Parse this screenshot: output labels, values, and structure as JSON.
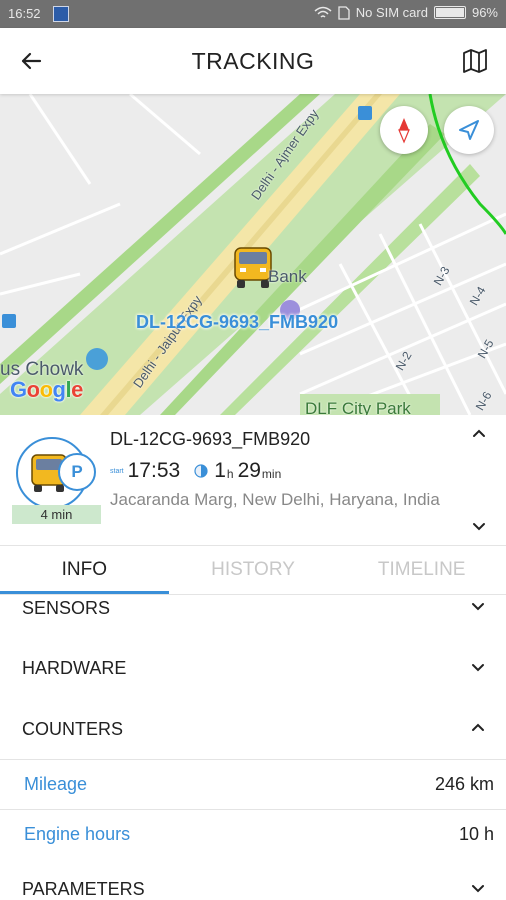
{
  "status_bar": {
    "time": "16:52",
    "carrier": "No SIM card",
    "battery": "96%"
  },
  "toolbar": {
    "title": "TRACKING",
    "back_icon": "arrow-left-icon",
    "map_icon": "map-icon"
  },
  "map": {
    "vehicle_label": "DL-12CG-9693_FMB920",
    "google_logo": "Google",
    "labels": {
      "road_1": "Delhi - Ajmer Expy",
      "road_2": "Delhi - Jaipur Expy",
      "place_1": "Bank",
      "place_2": "us Chowk",
      "place_3": "DLF City Park",
      "n3": "N-3",
      "n4": "N-4",
      "n2": "N-2",
      "n5": "N-5",
      "n6": "N-6"
    }
  },
  "vehicle": {
    "name": "DL-12CG-9693_FMB920",
    "start_tag": "start",
    "start_time": "17:53",
    "duration_hours": "1",
    "duration_hours_unit": "h",
    "duration_minutes": "29",
    "duration_minutes_unit": "min",
    "address": "Jacaranda Marg, New Delhi, Haryana, India",
    "parking_badge": "P",
    "badge_duration": "4 min"
  },
  "tabs": [
    {
      "label": "INFO",
      "active": true
    },
    {
      "label": "HISTORY",
      "active": false
    },
    {
      "label": "TIMELINE",
      "active": false
    }
  ],
  "sections": {
    "sensors": "SENSORS",
    "hardware": "HARDWARE",
    "counters": "COUNTERS",
    "parameters": "PARAMETERS"
  },
  "counters": [
    {
      "label": "Mileage",
      "value": "246 km"
    },
    {
      "label": "Engine hours",
      "value": "10 h"
    }
  ],
  "colors": {
    "accent": "#3a8fd8",
    "road_green": "#a8d888",
    "road_yellow": "#f4e6a8",
    "route_green": "#22cc22"
  }
}
